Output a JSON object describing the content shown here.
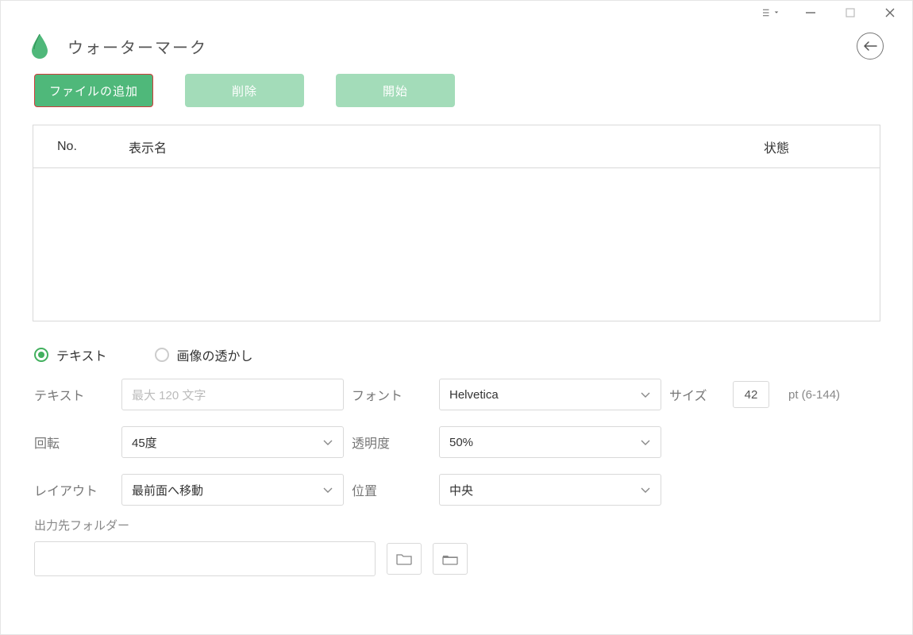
{
  "header": {
    "title": "ウォーターマーク"
  },
  "buttons": {
    "add_file": "ファイルの追加",
    "delete": "削除",
    "start": "開始"
  },
  "table": {
    "col_no": "No.",
    "col_name": "表示名",
    "col_state": "状態"
  },
  "wm_type": {
    "text": "テキスト",
    "image": "画像の透かし"
  },
  "form": {
    "text_label": "テキスト",
    "text_placeholder": "最大 120 文字",
    "font_label": "フォント",
    "font_value": "Helvetica",
    "size_label": "サイズ",
    "size_value": "42",
    "size_hint": "pt (6-144)",
    "rotation_label": "回転",
    "rotation_value": "45度",
    "opacity_label": "透明度",
    "opacity_value": "50%",
    "layout_label": "レイアウト",
    "layout_value": "最前面へ移動",
    "position_label": "位置",
    "position_value": "中央"
  },
  "output": {
    "label": "出力先フォルダー",
    "path": ""
  }
}
